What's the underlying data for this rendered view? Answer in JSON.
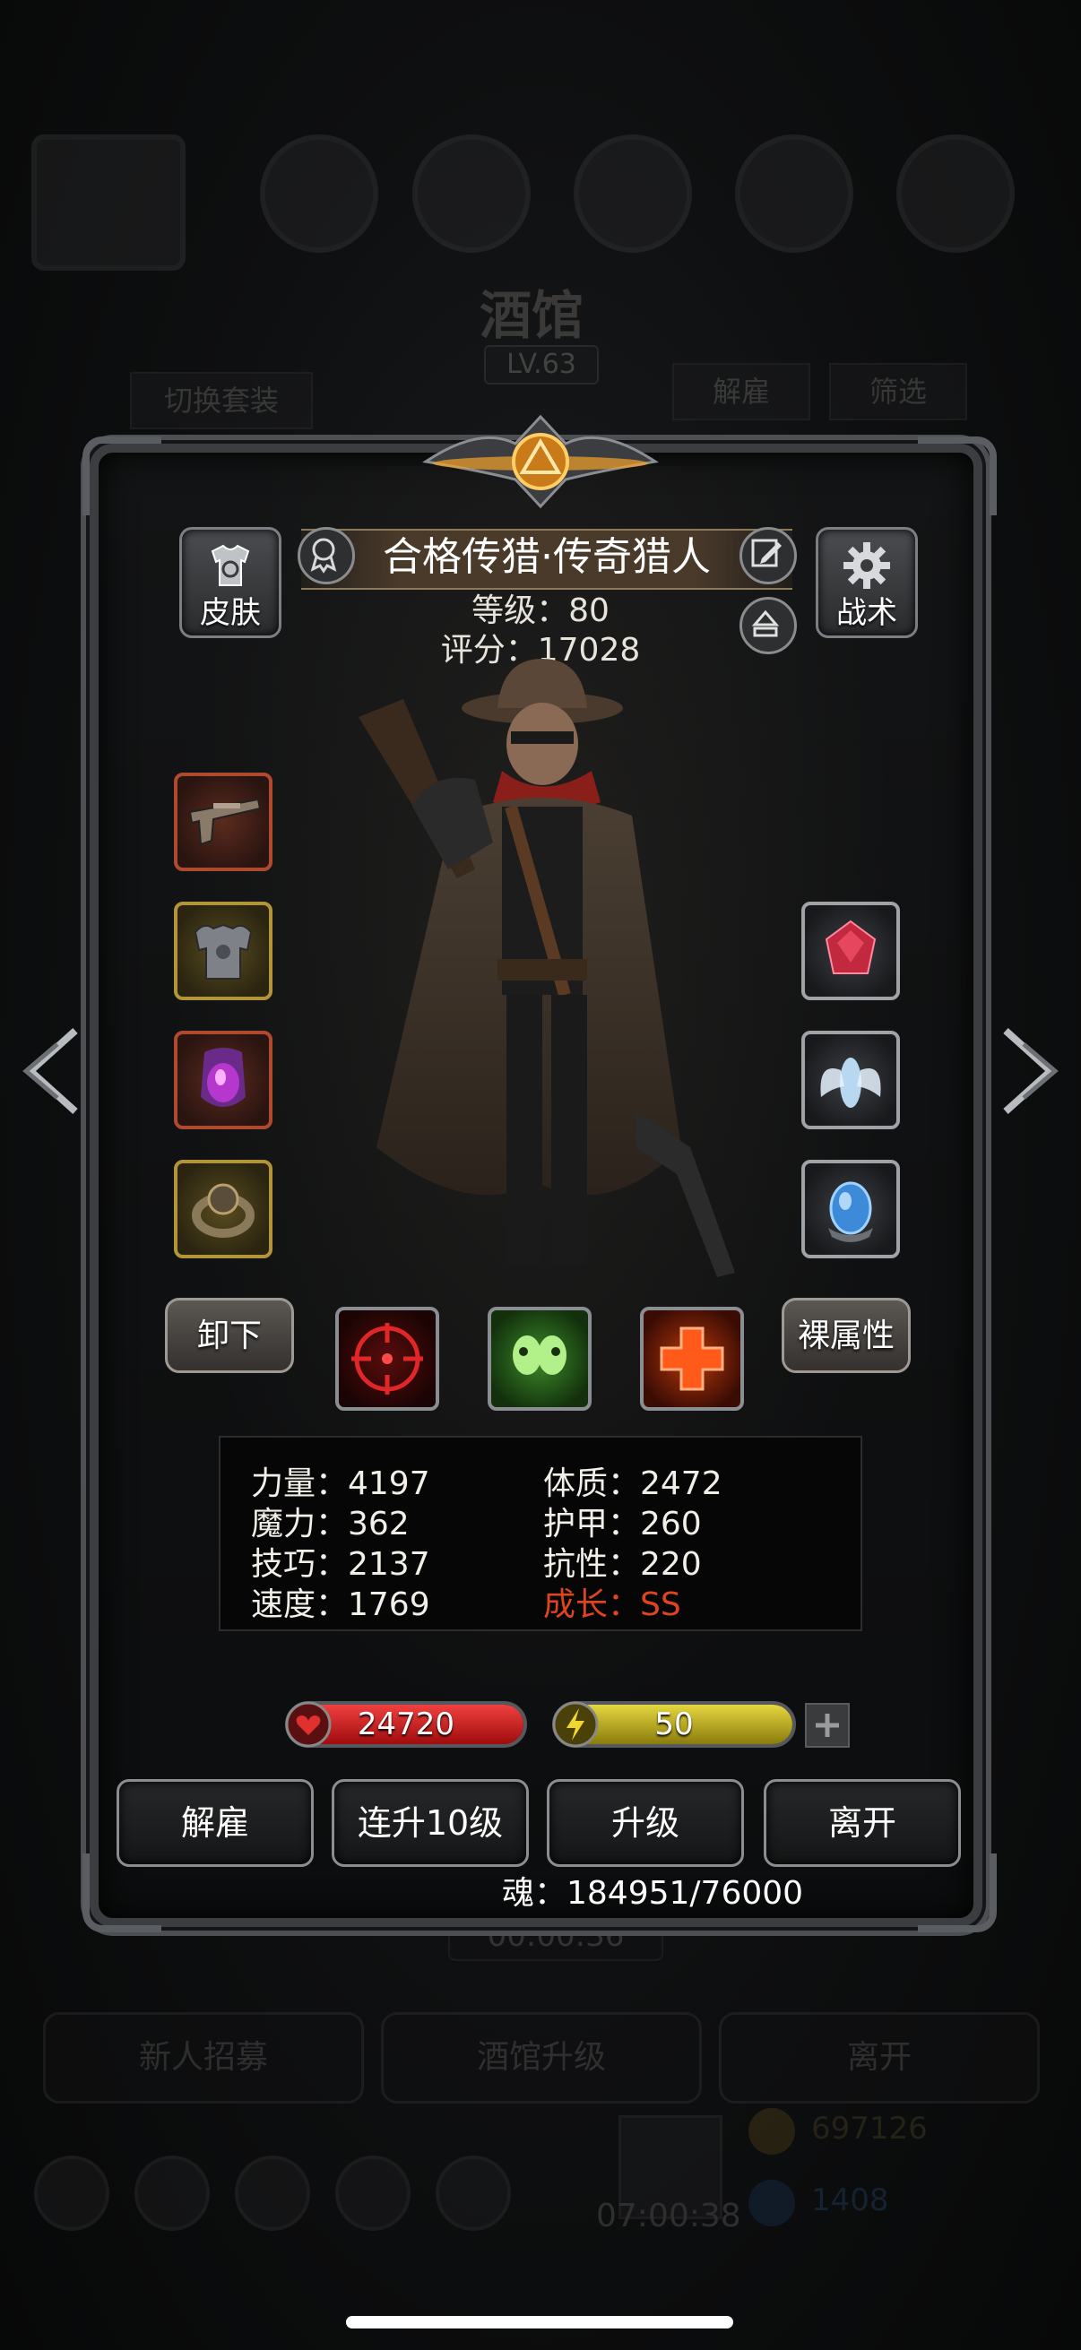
{
  "background": {
    "tavern_title": "酒馆",
    "tavern_level": "LV.63",
    "switch_outfit": "切换套装",
    "dismiss": "解雇",
    "filter": "筛选",
    "timer": "00:00:36",
    "recruit": "新人招募",
    "tavern_upgrade": "酒馆升级",
    "leave": "离开",
    "bottom_timer": "07:00:38",
    "gold": "697126",
    "gems": "1408"
  },
  "hero": {
    "name": "合格传猎·传奇猎人",
    "level": "等级：80",
    "score": "评分：17028",
    "skin_label": "皮肤",
    "tactics_label": "战术"
  },
  "equipment": {
    "left": [
      "pistol",
      "chest-armor",
      "purple-relic",
      "gold-ring"
    ],
    "right": [
      "ruby-gem",
      "ice-cicada",
      "crystal-egg"
    ]
  },
  "controls": {
    "unequip": "卸下",
    "base_attributes": "裸属性"
  },
  "skills": [
    "crosshair-skill",
    "twin-skull-skill",
    "red-cross-skill"
  ],
  "stats": {
    "left": [
      "力量：4197",
      "魔力：362",
      "技巧：2137",
      "速度：1769"
    ],
    "right": [
      "体质：2472",
      "护甲：260",
      "抗性：220",
      "成长：SS"
    ]
  },
  "bars": {
    "hp_value": "24720",
    "hp_fill": 1.0,
    "energy_value": "50",
    "energy_fill": 1.0
  },
  "actions": {
    "dismiss": "解雇",
    "level_up_10": "连升10级",
    "level_up": "升级",
    "leave": "离开"
  },
  "soul": "魂：184951/76000",
  "colors": {
    "hp": "#d21b1b",
    "energy": "#c8b81a",
    "growth_highlight": "#e0441f"
  }
}
